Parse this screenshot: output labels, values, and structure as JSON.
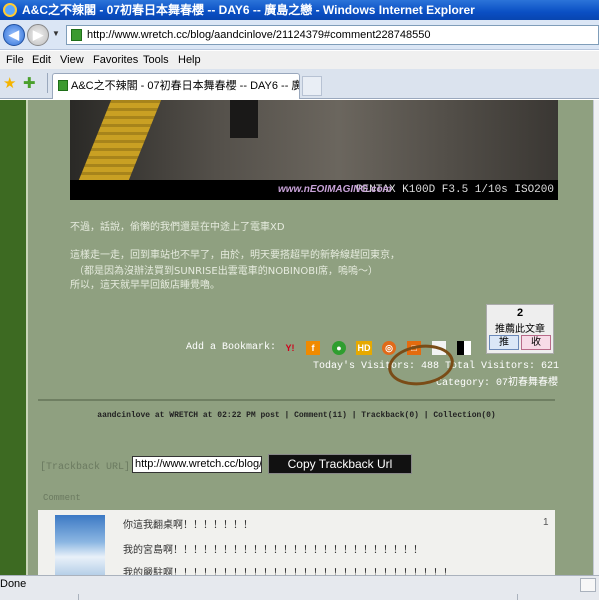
{
  "window": {
    "title": "A&C之不辣閣 - 07初春日本舞春櫻 -- DAY6 -- 廣島之戀 - Windows Internet Explorer"
  },
  "address_bar": {
    "url": "http://www.wretch.cc/blog/aandcinlove/21124379#comment228748550"
  },
  "menu": [
    "File",
    "Edit",
    "View",
    "Favorites",
    "Tools",
    "Help"
  ],
  "tab": {
    "label": "A&C之不辣閣 - 07初春日本舞春櫻 -- DAY6 -- 廣島..."
  },
  "photo": {
    "watermark": "www.nEOIMAGING.com",
    "caption": "PENTAX K100D F3.5 1/10s ISO200"
  },
  "body_text": [
    "不過，話說，偷懶的我們還是在中途上了電車XD",
    "這樣走一走，回到車站也不早了，由於，明天要搭超早的新幹線趕回東京，",
    "（都是因為沒辦法買到SUNRISE出雲電車的NOBINOBI席，嗚嗚～）",
    "所以，這天就早早回飯店睡覺嚕。"
  ],
  "push_box": {
    "count": "2",
    "label": "推薦此文章",
    "push_button": "推",
    "collect_button": "收"
  },
  "bookmark": {
    "label": "Add a Bookmark:",
    "icons": [
      "yahoo-icon",
      "funp-icon",
      "hemidemi-icon",
      "hd-icon",
      "myshare-icon",
      "udn-icon",
      "google-icon",
      "delicious-icon"
    ]
  },
  "stats": {
    "visitors_line": "Today's Visitors: 488 Total Visitors: 621",
    "category_line": "Category: 07初春舞春櫻"
  },
  "post_info": "aandcinlove at WRETCH at 02:22 PM post | Comment(11) | Trackback(0) | Collection(0)",
  "trackback": {
    "label": "[Trackback URL]",
    "value": "http://www.wretch.cc/blog/aandcinlove/21124379",
    "button": "Copy Trackback Url"
  },
  "comments": {
    "heading": "Comment",
    "first": {
      "number": "1",
      "lines": [
        "你這我翻桌啊！！！！！！！",
        "我的宮島啊！！！！！！！！！！！！！！！！！！！！！！！！！",
        "我的嚴駐啊！！！！！！！！！！！！！！！！！！！！！！！！！！！！"
      ]
    }
  },
  "status_bar": {
    "text": "Done"
  },
  "colors": {
    "page_background": "#8fa080",
    "left_bar": "#3d6a22",
    "annotation_circle": "#7a4c17"
  }
}
